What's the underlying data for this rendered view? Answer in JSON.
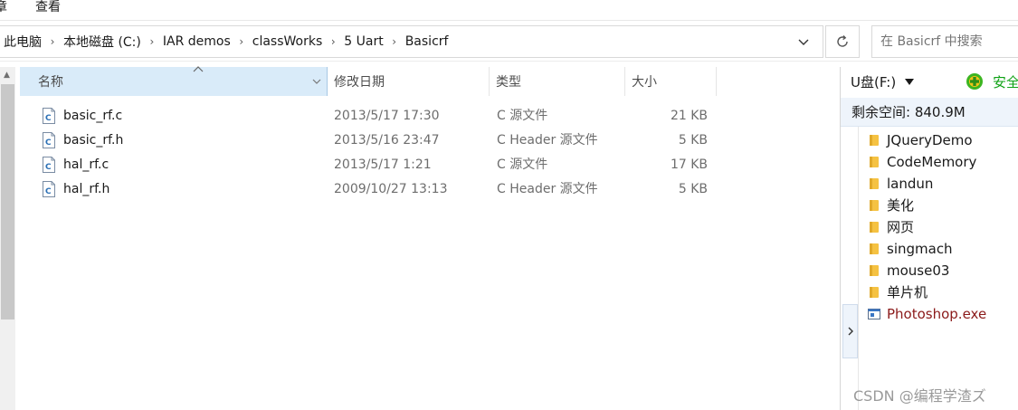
{
  "ribbon": {
    "tab_partial": "章",
    "tab_view": "查看"
  },
  "address": {
    "crumbs": [
      "此电脑",
      "本地磁盘 (C:)",
      "IAR demos",
      "classWorks",
      "5 Uart",
      "Basicrf"
    ]
  },
  "search": {
    "placeholder": "在 Basicrf 中搜索"
  },
  "columns": {
    "name": "名称",
    "date": "修改日期",
    "type": "类型",
    "size": "大小"
  },
  "files": [
    {
      "name": "basic_rf.c",
      "date": "2013/5/17 17:30",
      "type": "C 源文件",
      "size": "21 KB",
      "icon": "c-source-file-icon"
    },
    {
      "name": "basic_rf.h",
      "date": "2013/5/16 23:47",
      "type": "C Header 源文件",
      "size": "5 KB",
      "icon": "c-header-file-icon"
    },
    {
      "name": "hal_rf.c",
      "date": "2013/5/17 1:21",
      "type": "C 源文件",
      "size": "17 KB",
      "icon": "c-source-file-icon"
    },
    {
      "name": "hal_rf.h",
      "date": "2009/10/27 13:13",
      "type": "C Header 源文件",
      "size": "5 KB",
      "icon": "c-header-file-icon"
    }
  ],
  "usb_panel": {
    "drive_label": "U盘(F:)",
    "safe_label": "安全",
    "free_space": "剩余空间: 840.9M",
    "items": [
      {
        "name": "JQueryDemo",
        "kind": "folder"
      },
      {
        "name": "CodeMemory",
        "kind": "folder"
      },
      {
        "name": "landun",
        "kind": "folder"
      },
      {
        "name": "美化",
        "kind": "folder"
      },
      {
        "name": "网页",
        "kind": "folder"
      },
      {
        "name": "singmach",
        "kind": "folder"
      },
      {
        "name": "mouse03",
        "kind": "folder"
      },
      {
        "name": "单片机",
        "kind": "folder"
      },
      {
        "name": "Photoshop.exe",
        "kind": "exe"
      }
    ]
  },
  "watermark": "CSDN @编程学渣ズ",
  "colors": {
    "column_header_selected": "#d9ebf9",
    "exe_text": "#8b1a1a",
    "safe_green": "#0ea114",
    "folder_yellow": "#f5c242"
  }
}
